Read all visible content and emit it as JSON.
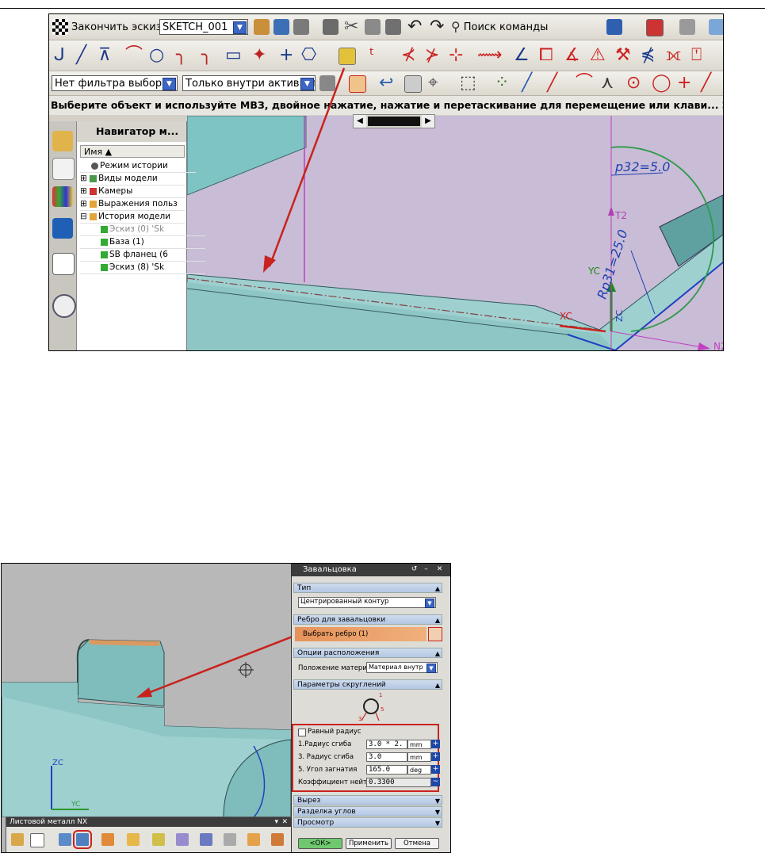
{
  "sketch_window": {
    "toolbar1": {
      "finish_sketch_label": "Закончить эскиз",
      "sketch_name": "SKETCH_001",
      "command_search_label": "Поиск команды"
    },
    "filter": {
      "selection_filter": "Нет фильтра выбора",
      "scope": "Только внутри активного"
    },
    "status_text": "Выберите объект и используйте МВЗ, двойное нажатие, нажатие и перетаскивание для перемещение или клави... Эскиз полность",
    "navigator": {
      "title": "Навигатор м...",
      "column_header": "Имя",
      "items": [
        "Режим истории",
        "Виды модели",
        "Камеры",
        "Выражения польз",
        "История модели",
        "Эскиз (0) 'Sk",
        "База (1)",
        "SB фланец (6",
        "Эскиз (8) 'Sk"
      ]
    },
    "viewport_labels": {
      "dimension_1": "p32=5.0",
      "dimension_2": "Rp31=25.0",
      "axis_t": "T2",
      "axis_yc": "YC",
      "axis_xc": "XC",
      "axis_n": "N2",
      "axis_zc": "ZC"
    }
  },
  "roll_dialog": {
    "title": "Завальцовка",
    "sections": {
      "type": "Тип",
      "edge": "Ребро для завальцовки",
      "placement": "Опции расположения",
      "fillet_params": "Параметры скруглений",
      "cutout": "Вырез",
      "corner_relief": "Разделка углов",
      "preview": "Просмотр"
    },
    "type_value": "Центрированный контур",
    "select_edge": "Выбрать ребро (1)",
    "material_position_label": "Положение материа",
    "material_position_value": "Материал внутр",
    "equal_radius_label": "Равный радиус",
    "params": [
      {
        "label": "1.Радиус сгиба",
        "value": "3.0 * 2.",
        "unit": "mm"
      },
      {
        "label": "3. Радиус сгиба",
        "value": "3.0",
        "unit": "mm"
      },
      {
        "label": "5. Угол загнатия",
        "value": "165.0",
        "unit": "deg"
      }
    ],
    "neutral_factor_label": "Коэффициент нейтре",
    "neutral_factor_value": "0.3300",
    "ok_label": "<ОК>",
    "apply_label": "Применить",
    "cancel_label": "Отмена",
    "diagram_labels": [
      "1",
      "3",
      "5"
    ]
  },
  "sheet_metal_toolbar": {
    "title": "Листовой металл NX"
  },
  "bottom_viewport_labels": {
    "axis_zc": "ZC",
    "axis_yc": "YC"
  },
  "colors": {
    "arrow": "#c8231e",
    "highlight_box": "#c8231e",
    "model_face": "#8ec6c6",
    "viewport_bg": "#c9bcd6",
    "select_edge_bar": "#e6925a",
    "dimension_blue": "#1e3fb0",
    "arc_green": "#2e9a4a"
  }
}
